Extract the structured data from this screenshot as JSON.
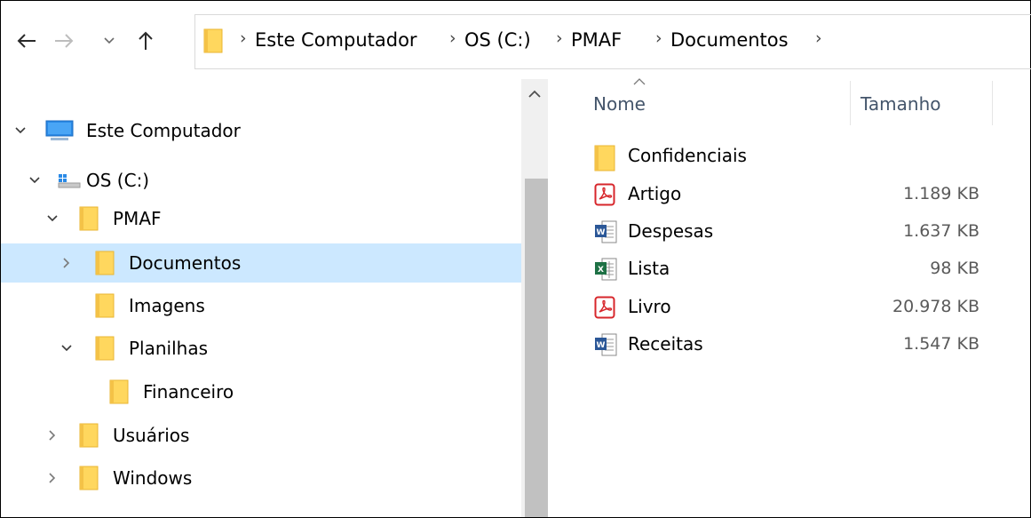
{
  "breadcrumb": [
    "Este Computador",
    "OS (C:)",
    "PMAF",
    "Documentos"
  ],
  "nav_tree": [
    {
      "label": "Este Computador",
      "icon": "computer-icon",
      "expanded": true
    },
    {
      "label": "OS (C:)",
      "icon": "drive-icon",
      "expanded": true
    },
    {
      "label": "PMAF",
      "icon": "folder-icon",
      "expanded": true
    },
    {
      "label": "Documentos",
      "icon": "folder-icon",
      "expanded": false,
      "selected": true
    },
    {
      "label": "Imagens",
      "icon": "folder-icon"
    },
    {
      "label": "Planilhas",
      "icon": "folder-icon",
      "expanded": true
    },
    {
      "label": "Financeiro",
      "icon": "folder-icon"
    },
    {
      "label": "Usuários",
      "icon": "folder-icon",
      "expanded": false
    },
    {
      "label": "Windows",
      "icon": "folder-icon",
      "expanded": false
    }
  ],
  "columns": {
    "name": "Nome",
    "size": "Tamanho",
    "sorted_by": "name"
  },
  "files": [
    {
      "name": "Confidenciais",
      "type": "folder",
      "size": ""
    },
    {
      "name": "Artigo",
      "type": "pdf",
      "size": "1.189 KB"
    },
    {
      "name": "Despesas",
      "type": "word",
      "size": "1.637 KB"
    },
    {
      "name": "Lista",
      "type": "excel",
      "size": "98 KB"
    },
    {
      "name": "Livro",
      "type": "pdf",
      "size": "20.978 KB"
    },
    {
      "name": "Receitas",
      "type": "word",
      "size": "1.547 KB"
    }
  ],
  "colors": {
    "selection": "#cce8ff",
    "folder": "#ffd75e",
    "pdf": "#d7262b",
    "word": "#2b5797",
    "excel": "#1e7145"
  }
}
